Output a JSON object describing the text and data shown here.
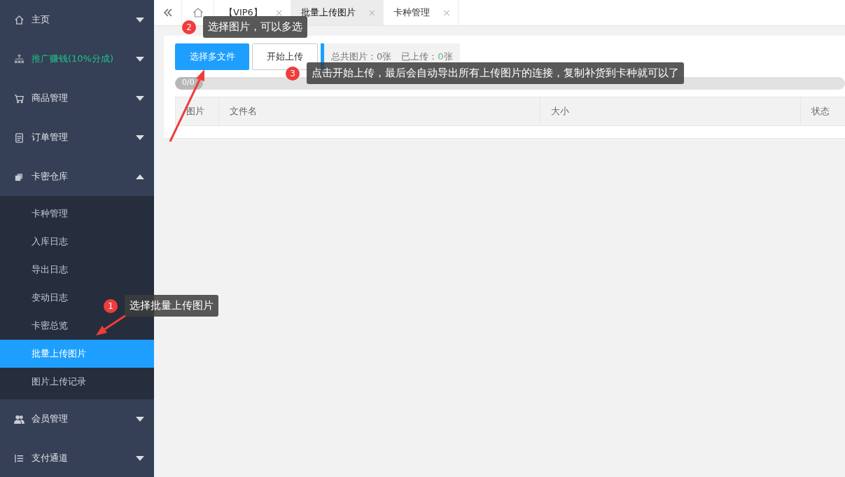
{
  "sidebar": {
    "items": [
      {
        "label": "主页",
        "kind": "home",
        "expanded": false,
        "highlight": false
      },
      {
        "label": "推广赚钱(10%分成)",
        "kind": "tree",
        "expanded": false,
        "highlight": true
      },
      {
        "label": "商品管理",
        "kind": "cart",
        "expanded": false,
        "highlight": false
      },
      {
        "label": "订单管理",
        "kind": "clipboard",
        "expanded": false,
        "highlight": false
      },
      {
        "label": "卡密仓库",
        "kind": "cards",
        "expanded": true,
        "highlight": false,
        "children": [
          {
            "label": "卡种管理",
            "selected": false
          },
          {
            "label": "入库日志",
            "selected": false
          },
          {
            "label": "导出日志",
            "selected": false
          },
          {
            "label": "变动日志",
            "selected": false
          },
          {
            "label": "卡密总览",
            "selected": false
          },
          {
            "label": "批量上传图片",
            "selected": true
          },
          {
            "label": "图片上传记录",
            "selected": false
          }
        ]
      },
      {
        "label": "会员管理",
        "kind": "users",
        "expanded": false,
        "highlight": false
      },
      {
        "label": "支付通道",
        "kind": "list",
        "expanded": false,
        "highlight": false
      }
    ]
  },
  "tabs": [
    {
      "label": "【VIP6】",
      "selected": false,
      "close": "×"
    },
    {
      "label": "批量上传图片",
      "selected": true,
      "close": "×"
    },
    {
      "label": "卡种管理",
      "selected": false,
      "close": "×"
    }
  ],
  "upload": {
    "select_button": "选择多文件",
    "start_button": "开始上传",
    "total_label": "总共图片：",
    "total_value": "0张",
    "uploaded_label": "已上传：",
    "uploaded_count": "0",
    "uploaded_unit": "张",
    "progress": {
      "level": 0,
      "reading": "0/0"
    },
    "table": {
      "columns": [
        "图片",
        "文件名",
        "大小",
        "状态"
      ]
    }
  },
  "annotations": [
    {
      "number": "1",
      "text": "选择批量上传图片"
    },
    {
      "number": "2",
      "text": "选择图片，可以多选"
    },
    {
      "number": "3",
      "text": "点击开始上传，最后会自动导出所有上传图片的连接，复制补货到卡种就可以了"
    }
  ]
}
